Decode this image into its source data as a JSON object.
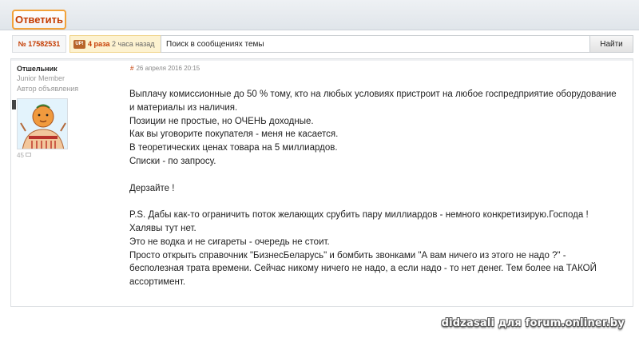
{
  "toolbar": {
    "reply_label": "Ответить"
  },
  "infobar": {
    "post_id": "№ 17582531",
    "up_icon": "UP!",
    "up_count": "4 раза",
    "up_time": "2 часа назад",
    "search_placeholder": "Поиск в сообщениях темы",
    "search_button": "Найти"
  },
  "post": {
    "author": {
      "name": "Отшельник",
      "rank": "Junior Member",
      "role": "Автор объявления",
      "rating": "45"
    },
    "meta": {
      "hash": "#",
      "date": "26 апреля 2016 20:15"
    },
    "lines": [
      "Выплачу комиссионные до 50 % тому, кто на любых условиях пристроит на любое госпредприятие оборудование и материалы из наличия.",
      "Позиции не простые, но ОЧЕНЬ доходные.",
      "Как вы уговорите покупателя - меня не касается.",
      "В теоретических ценах товара на 5 миллиардов.",
      "Списки - по запросу.",
      "Дерзайте !",
      "P.S. Дабы как-то ограничить поток желающих срубить пару миллиардов - немного конкретизирую.Господа ! Халявы тут нет.",
      "Это не водка и не сигареты - очередь не стоит.",
      "Просто открыть справочник \"БизнесБеларусь\" и бомбить звонками \"А вам ничего из этого не надо ?\" - бесполезная трата времени. Сейчас никому ничего не надо, а если надо - то нет денег. Тем более на ТАКОЙ ассортимент."
    ]
  },
  "watermark": "didzasali для forum.onliner.by",
  "colors": {
    "accent": "#c43b00",
    "reply_border": "#f2a23a",
    "up_bg": "#fdf2d0"
  }
}
